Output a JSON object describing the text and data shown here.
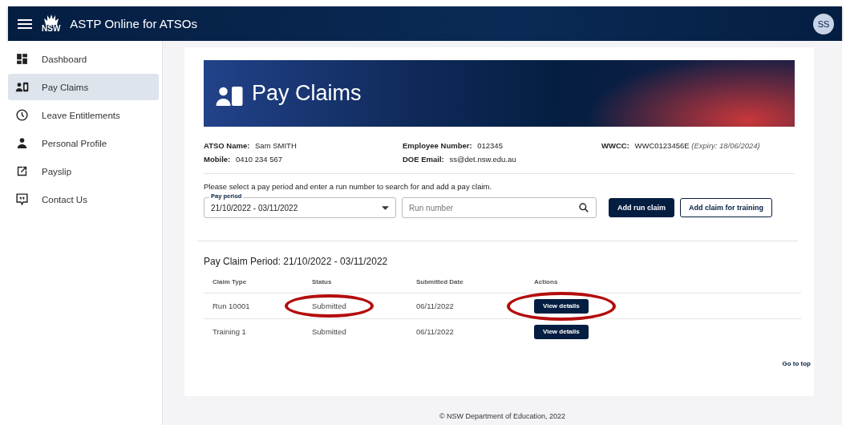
{
  "app_bar": {
    "title": "ASTP Online for ATSOs",
    "logo_text": "NSW",
    "avatar": "SS"
  },
  "sidebar": {
    "items": [
      {
        "label": "Dashboard",
        "kind": "dashboard",
        "selected": false
      },
      {
        "label": "Pay Claims",
        "kind": "badge",
        "selected": true
      },
      {
        "label": "Leave Entitlements",
        "kind": "clock",
        "selected": false
      },
      {
        "label": "Personal Profile",
        "kind": "person",
        "selected": false
      },
      {
        "label": "Payslip",
        "kind": "external",
        "selected": false
      },
      {
        "label": "Contact Us",
        "kind": "chat",
        "selected": false
      }
    ]
  },
  "banner": {
    "title": "Pay Claims"
  },
  "details": [
    {
      "label": "ATSO Name:",
      "value": "Sam SMITH"
    },
    {
      "label": "Employee Number:",
      "value": "012345"
    },
    {
      "label": "WWCC:",
      "value": "WWC0123456E",
      "note": "(Expiry: 18/06/2024)"
    },
    {
      "label": "Mobile:",
      "value": "0410 234 567"
    },
    {
      "label": "DOE Email:",
      "value": "ss@det.nsw.edu.au"
    }
  ],
  "instructions": "Please select a pay period and enter a run number to search for and add a pay claim.",
  "pay_period": {
    "label": "Pay period",
    "value": "21/10/2022 - 03/11/2022"
  },
  "run_number": {
    "placeholder": "Run number"
  },
  "buttons": [
    {
      "label": "Add run claim",
      "kind": "primary"
    },
    {
      "label": "Add claim for training",
      "kind": "outline"
    }
  ],
  "period_heading": "Pay Claim Period: 21/10/2022 - 03/11/2022",
  "table": {
    "columns": [
      "Claim Type",
      "Status",
      "Submitted Date",
      "Actions"
    ],
    "rows": [
      {
        "claim_type": "Run 10001",
        "status": "Submitted",
        "submitted_date": "06/11/2022",
        "action": "View details",
        "status_circled": true,
        "action_circled": true
      },
      {
        "claim_type": "Training 1",
        "status": "Submitted",
        "submitted_date": "06/11/2022",
        "action": "View details",
        "status_circled": false,
        "action_circled": false
      }
    ]
  },
  "go_to_top": "Go to top",
  "footer": "© NSW Department of Education, 2022"
}
